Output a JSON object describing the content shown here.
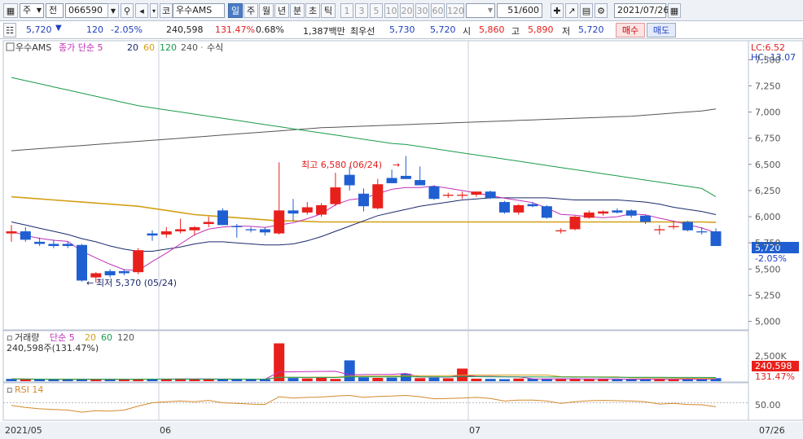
{
  "toolbar": {
    "item1": "주",
    "item2": "전",
    "code": "066590",
    "market": "코",
    "name": "우수AMS",
    "periods": [
      "일",
      "주",
      "월",
      "년",
      "분",
      "초",
      "틱"
    ],
    "selected_period": "일",
    "nums": [
      "1",
      "3",
      "5",
      "10",
      "20",
      "30",
      "60",
      "120"
    ],
    "count": "51",
    "count_total": "/600",
    "date": "2021/07/26"
  },
  "quote": {
    "price": "5,720",
    "change": "120",
    "change_pct": "-2.05%",
    "volume": "240,598",
    "vol_ratio": "131.47%",
    "turnover": "0.68%",
    "amount": "1,387백만",
    "best_label": "최우선",
    "best_ask": "5,730",
    "best_bid": "5,720",
    "open_label": "시",
    "open": "5,860",
    "high_label": "고",
    "high": "5,890",
    "low_label": "저",
    "low": "5,720",
    "buy_label": "매수",
    "sell_label": "매도"
  },
  "colors": {
    "up": "#e8201c",
    "down": "#1f5fd1",
    "ma5": "#c02fb8",
    "ma20": "#1b2a6b",
    "ma60": "#d4a017",
    "ma120": "#1a9a4a",
    "ma240": "#555555",
    "rsi": "#d28a2c"
  },
  "chart_data": {
    "type": "candlestick",
    "price_legend": {
      "name": "우수AMS",
      "ma_label": "종가 단순",
      "ma": [
        "5",
        "20",
        "60",
        "120",
        "240"
      ],
      "extra": "수식"
    },
    "lc_label": "LC:6.52",
    "hc_label": "HC:-13.07",
    "ylim": [
      4950,
      7650
    ],
    "y_ticks": [
      5000,
      5250,
      5500,
      5750,
      6000,
      6250,
      6500,
      6750,
      7000,
      7250,
      7500
    ],
    "y_tick_labels": [
      "5,000",
      "5,250",
      "5,500",
      "5,750",
      "6,000",
      "6,250",
      "6,500",
      "6,750",
      "7,000",
      "7,250",
      "7,500"
    ],
    "current_price_label": "5,720",
    "current_change_label": "-2.05%",
    "x_labels": [
      "2021/05",
      "06",
      "07"
    ],
    "x_label_right": "07/26",
    "annotations": {
      "high": "최고 6,580 (06/24)",
      "low": "최저 5,370 (05/24)"
    },
    "candles": [
      {
        "o": 5840,
        "h": 5920,
        "l": 5760,
        "c": 5860
      },
      {
        "o": 5860,
        "h": 5900,
        "l": 5760,
        "c": 5780
      },
      {
        "o": 5760,
        "h": 5800,
        "l": 5720,
        "c": 5740
      },
      {
        "o": 5740,
        "h": 5780,
        "l": 5700,
        "c": 5720
      },
      {
        "o": 5740,
        "h": 5760,
        "l": 5700,
        "c": 5720
      },
      {
        "o": 5730,
        "h": 5740,
        "l": 5380,
        "c": 5390
      },
      {
        "o": 5420,
        "h": 5470,
        "l": 5370,
        "c": 5460
      },
      {
        "o": 5480,
        "h": 5500,
        "l": 5420,
        "c": 5440
      },
      {
        "o": 5480,
        "h": 5500,
        "l": 5440,
        "c": 5460
      },
      {
        "o": 5470,
        "h": 5700,
        "l": 5450,
        "c": 5680
      },
      {
        "o": 5840,
        "h": 5870,
        "l": 5770,
        "c": 5820
      },
      {
        "o": 5830,
        "h": 5900,
        "l": 5800,
        "c": 5860
      },
      {
        "o": 5860,
        "h": 5980,
        "l": 5840,
        "c": 5880
      },
      {
        "o": 5870,
        "h": 5910,
        "l": 5820,
        "c": 5900
      },
      {
        "o": 5930,
        "h": 6000,
        "l": 5900,
        "c": 5950
      },
      {
        "o": 6060,
        "h": 6080,
        "l": 5920,
        "c": 5920
      },
      {
        "o": 5910,
        "h": 5930,
        "l": 5800,
        "c": 5900
      },
      {
        "o": 5880,
        "h": 5900,
        "l": 5850,
        "c": 5870
      },
      {
        "o": 5880,
        "h": 5900,
        "l": 5820,
        "c": 5850
      },
      {
        "o": 5840,
        "h": 6520,
        "l": 5830,
        "c": 6060
      },
      {
        "o": 6060,
        "h": 6170,
        "l": 5960,
        "c": 6030
      },
      {
        "o": 6040,
        "h": 6140,
        "l": 6020,
        "c": 6090
      },
      {
        "o": 6020,
        "h": 6130,
        "l": 6000,
        "c": 6110
      },
      {
        "o": 6120,
        "h": 6420,
        "l": 6100,
        "c": 6280
      },
      {
        "o": 6400,
        "h": 6480,
        "l": 6250,
        "c": 6300
      },
      {
        "o": 6220,
        "h": 6270,
        "l": 6050,
        "c": 6100
      },
      {
        "o": 6080,
        "h": 6360,
        "l": 6070,
        "c": 6310
      },
      {
        "o": 6370,
        "h": 6450,
        "l": 6320,
        "c": 6320
      },
      {
        "o": 6390,
        "h": 6580,
        "l": 6360,
        "c": 6360
      },
      {
        "o": 6350,
        "h": 6480,
        "l": 6300,
        "c": 6300
      },
      {
        "o": 6290,
        "h": 6300,
        "l": 6160,
        "c": 6170
      },
      {
        "o": 6200,
        "h": 6230,
        "l": 6180,
        "c": 6210
      },
      {
        "o": 6200,
        "h": 6240,
        "l": 6170,
        "c": 6210
      },
      {
        "o": 6210,
        "h": 6240,
        "l": 6190,
        "c": 6240
      },
      {
        "o": 6240,
        "h": 6250,
        "l": 6170,
        "c": 6180
      },
      {
        "o": 6140,
        "h": 6150,
        "l": 6030,
        "c": 6040
      },
      {
        "o": 6040,
        "h": 6120,
        "l": 6020,
        "c": 6110
      },
      {
        "o": 6120,
        "h": 6140,
        "l": 6090,
        "c": 6100
      },
      {
        "o": 6100,
        "h": 6110,
        "l": 5980,
        "c": 5990
      },
      {
        "o": 5860,
        "h": 5890,
        "l": 5840,
        "c": 5870
      },
      {
        "o": 5880,
        "h": 6010,
        "l": 5870,
        "c": 6000
      },
      {
        "o": 5990,
        "h": 6060,
        "l": 5980,
        "c": 6040
      },
      {
        "o": 6030,
        "h": 6060,
        "l": 6010,
        "c": 6050
      },
      {
        "o": 6060,
        "h": 6080,
        "l": 6030,
        "c": 6040
      },
      {
        "o": 6060,
        "h": 6070,
        "l": 5990,
        "c": 6010
      },
      {
        "o": 6010,
        "h": 6020,
        "l": 5930,
        "c": 5950
      },
      {
        "o": 5870,
        "h": 5920,
        "l": 5830,
        "c": 5880
      },
      {
        "o": 5900,
        "h": 5960,
        "l": 5880,
        "c": 5910
      },
      {
        "o": 5950,
        "h": 5960,
        "l": 5860,
        "c": 5870
      },
      {
        "o": 5860,
        "h": 5900,
        "l": 5830,
        "c": 5850
      },
      {
        "o": 5860,
        "h": 5890,
        "l": 5720,
        "c": 5720
      }
    ],
    "ma_lines": {
      "ma20": [
        5950,
        5920,
        5890,
        5860,
        5830,
        5790,
        5760,
        5720,
        5690,
        5670,
        5670,
        5690,
        5710,
        5740,
        5760,
        5760,
        5750,
        5740,
        5730,
        5730,
        5740,
        5770,
        5810,
        5860,
        5910,
        5960,
        6010,
        6040,
        6070,
        6100,
        6120,
        6140,
        6160,
        6170,
        6180,
        6180,
        6180,
        6180,
        6180,
        6170,
        6160,
        6160,
        6160,
        6160,
        6150,
        6140,
        6120,
        6090,
        6070,
        6050,
        6020
      ],
      "ma60": [
        6190,
        6180,
        6170,
        6160,
        6150,
        6140,
        6130,
        6120,
        6110,
        6100,
        6080,
        6060,
        6040,
        6020,
        6010,
        6000,
        5990,
        5980,
        5970,
        5960,
        5960,
        5955,
        5950,
        5950,
        5950,
        5950,
        5950,
        5950,
        5950,
        5950,
        5950,
        5950,
        5950,
        5950,
        5950,
        5950,
        5950,
        5950,
        5950,
        5950,
        5950,
        5950,
        5950,
        5950,
        5950,
        5950,
        5950,
        5950,
        5950,
        5950,
        5945
      ],
      "ma120": [
        7330,
        7300,
        7270,
        7240,
        7210,
        7180,
        7150,
        7120,
        7090,
        7060,
        7040,
        7020,
        7000,
        6980,
        6960,
        6940,
        6920,
        6900,
        6880,
        6860,
        6840,
        6820,
        6800,
        6780,
        6760,
        6740,
        6720,
        6700,
        6690,
        6670,
        6650,
        6630,
        6610,
        6590,
        6570,
        6550,
        6530,
        6510,
        6490,
        6470,
        6450,
        6430,
        6410,
        6390,
        6370,
        6350,
        6330,
        6310,
        6290,
        6270,
        6190
      ],
      "ma240": [
        6630,
        6640,
        6650,
        6660,
        6670,
        6680,
        6690,
        6700,
        6710,
        6720,
        6730,
        6740,
        6750,
        6760,
        6770,
        6780,
        6790,
        6800,
        6810,
        6820,
        6830,
        6840,
        6850,
        6855,
        6860,
        6865,
        6870,
        6875,
        6880,
        6885,
        6890,
        6895,
        6900,
        6905,
        6910,
        6915,
        6920,
        6925,
        6930,
        6935,
        6940,
        6945,
        6950,
        6955,
        6960,
        6970,
        6980,
        6990,
        7000,
        7010,
        7030
      ]
    },
    "volume_legend": {
      "name": "거래량",
      "ma_label": "단순",
      "ma": [
        "5",
        "20",
        "60",
        "120"
      ]
    },
    "volume_text": "240,598주(131.47%)",
    "volume_ylim": [
      0,
      3100000
    ],
    "volume_tick": "2,500K",
    "volume_current_label": "240,598",
    "volume_pct_label": "131.47%",
    "volume": [
      180000,
      160000,
      140000,
      150000,
      130000,
      170000,
      150000,
      140000,
      160000,
      180000,
      190000,
      170000,
      200000,
      150000,
      160000,
      170000,
      150000,
      160000,
      150000,
      3000000,
      250000,
      220000,
      260000,
      180000,
      1650000,
      300000,
      260000,
      280000,
      590000,
      240000,
      280000,
      230000,
      1000000,
      200000,
      180000,
      160000,
      210000,
      190000,
      170000,
      200000,
      170000,
      160000,
      180000,
      150000,
      160000,
      170000,
      150000,
      160000,
      170000,
      150000,
      240598
    ],
    "volume_up": [
      false,
      true,
      false,
      false,
      false,
      false,
      true,
      false,
      true,
      true,
      false,
      true,
      true,
      true,
      true,
      false,
      false,
      false,
      false,
      true,
      false,
      true,
      true,
      true,
      false,
      false,
      true,
      false,
      false,
      true,
      false,
      true,
      true,
      true,
      false,
      false,
      true,
      false,
      false,
      true,
      true,
      true,
      true,
      false,
      false,
      false,
      true,
      true,
      false,
      false,
      false
    ],
    "rsi_legend": "RSI 14",
    "rsi_ylim": [
      0,
      100
    ],
    "rsi_tick": "50.00",
    "rsi": [
      42,
      36,
      32,
      30,
      28,
      22,
      26,
      25,
      28,
      40,
      50,
      53,
      55,
      53,
      57,
      50,
      48,
      46,
      45,
      68,
      64,
      66,
      67,
      70,
      72,
      66,
      69,
      70,
      72,
      68,
      62,
      63,
      64,
      66,
      63,
      55,
      58,
      58,
      55,
      48,
      53,
      56,
      57,
      56,
      55,
      53,
      46,
      48,
      45,
      44,
      38
    ]
  }
}
